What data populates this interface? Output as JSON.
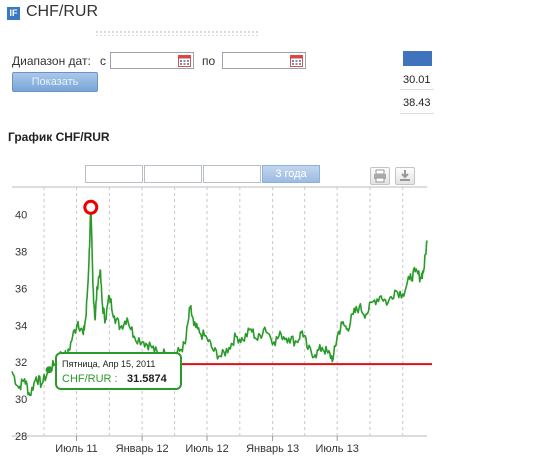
{
  "header": {
    "logo_text": "IF",
    "title": "CHF/RUR"
  },
  "filter": {
    "range_label": "Диапазон дат:",
    "from_label": "с",
    "to_label": "по",
    "from_value": "",
    "to_value": "",
    "show_button": "Показать"
  },
  "legend": {
    "color": "#3f73be",
    "min": "30.01",
    "max": "38.43"
  },
  "chart_title": "График CHF/RUR",
  "toolbar": {
    "zoom_buttons": [
      "",
      "",
      "",
      "3 года"
    ],
    "active_zoom": 3,
    "print_icon": "printer-icon",
    "download_icon": "download-icon"
  },
  "tooltip": {
    "date": "Пятница, Апр 15, 2011",
    "label": "CHF/RUR :",
    "value": "31.5874"
  },
  "chart_data": {
    "type": "line",
    "title": "График CHF/RUR",
    "xlabel": "",
    "ylabel": "",
    "y_ticks": [
      "28",
      "30",
      "32",
      "34",
      "36",
      "38",
      "40"
    ],
    "x_ticks": [
      "Июль 11",
      "Январь 12",
      "Июль 12",
      "Январь 13",
      "Июль 13"
    ],
    "ylim": [
      28,
      41.5
    ],
    "grid": true,
    "line_color": "#2a9a2a",
    "reference_line": {
      "value": 31.9,
      "color": "#dd1111"
    },
    "max_marker": {
      "date": "2011-08-10",
      "value": 40.4
    },
    "highlight_point": {
      "date": "2011-04-15",
      "value": 31.5874
    },
    "series": [
      {
        "points": [
          [
            "2011-01-01",
            31.5
          ],
          [
            "2011-01-20",
            30.6
          ],
          [
            "2011-02-05",
            31.1
          ],
          [
            "2011-02-20",
            30.2
          ],
          [
            "2011-03-10",
            31.2
          ],
          [
            "2011-03-25",
            30.8
          ],
          [
            "2011-04-15",
            31.5874
          ],
          [
            "2011-05-01",
            31.9
          ],
          [
            "2011-05-20",
            32.5
          ],
          [
            "2011-06-05",
            32.3
          ],
          [
            "2011-06-20",
            33.4
          ],
          [
            "2011-07-05",
            34.2
          ],
          [
            "2011-07-20",
            33.5
          ],
          [
            "2011-07-28",
            34.6
          ],
          [
            "2011-08-05",
            37.5
          ],
          [
            "2011-08-10",
            40.4
          ],
          [
            "2011-08-16",
            36.2
          ],
          [
            "2011-08-22",
            34.3
          ],
          [
            "2011-08-28",
            36.1
          ],
          [
            "2011-09-05",
            37.0
          ],
          [
            "2011-09-12",
            35.0
          ],
          [
            "2011-09-20",
            34.3
          ],
          [
            "2011-10-01",
            35.6
          ],
          [
            "2011-10-15",
            34.5
          ],
          [
            "2011-11-01",
            33.9
          ],
          [
            "2011-11-20",
            34.4
          ],
          [
            "2011-12-10",
            33.4
          ],
          [
            "2012-01-05",
            33.1
          ],
          [
            "2012-01-25",
            32.9
          ],
          [
            "2012-02-15",
            32.4
          ],
          [
            "2012-03-05",
            32.5
          ],
          [
            "2012-03-25",
            32.3
          ],
          [
            "2012-04-15",
            32.6
          ],
          [
            "2012-05-01",
            33.0
          ],
          [
            "2012-05-15",
            35.0
          ],
          [
            "2012-05-25",
            34.0
          ],
          [
            "2012-06-10",
            33.6
          ],
          [
            "2012-07-01",
            33.3
          ],
          [
            "2012-07-20",
            32.6
          ],
          [
            "2012-08-10",
            32.3
          ],
          [
            "2012-09-01",
            32.8
          ],
          [
            "2012-09-20",
            33.4
          ],
          [
            "2012-10-10",
            33.2
          ],
          [
            "2012-11-01",
            33.8
          ],
          [
            "2012-11-20",
            33.2
          ],
          [
            "2012-12-10",
            33.9
          ],
          [
            "2013-01-05",
            33.1
          ],
          [
            "2013-01-25",
            33.5
          ],
          [
            "2013-02-15",
            33.3
          ],
          [
            "2013-03-10",
            33.1
          ],
          [
            "2013-03-25",
            33.7
          ],
          [
            "2013-04-10",
            32.7
          ],
          [
            "2013-04-30",
            32.4
          ],
          [
            "2013-05-20",
            32.8
          ],
          [
            "2013-06-05",
            32.5
          ],
          [
            "2013-06-20",
            32.2
          ],
          [
            "2013-07-01",
            33.4
          ],
          [
            "2013-07-15",
            34.1
          ],
          [
            "2013-07-30",
            33.8
          ],
          [
            "2013-08-15",
            34.6
          ],
          [
            "2013-09-01",
            35.0
          ],
          [
            "2013-09-20",
            34.6
          ],
          [
            "2013-10-10",
            35.3
          ],
          [
            "2013-11-01",
            35.6
          ],
          [
            "2013-11-20",
            35.2
          ],
          [
            "2013-12-10",
            35.9
          ],
          [
            "2014-01-01",
            35.7
          ],
          [
            "2014-01-20",
            36.5
          ],
          [
            "2014-02-05",
            36.9
          ],
          [
            "2014-02-20",
            36.6
          ],
          [
            "2014-03-01",
            37.0
          ],
          [
            "2014-03-10",
            38.6
          ]
        ]
      }
    ]
  }
}
